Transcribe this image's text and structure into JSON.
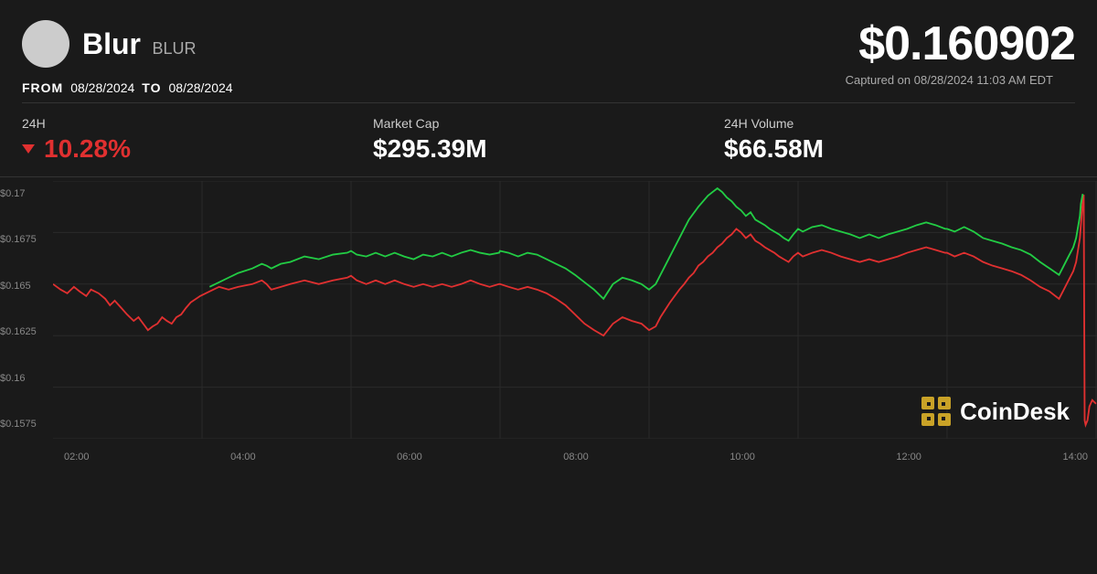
{
  "header": {
    "coin_name": "Blur",
    "coin_ticker": "BLUR",
    "price": "$0.160902",
    "date_from_label": "FROM",
    "date_from": "08/28/2024",
    "date_to_label": "TO",
    "date_to": "08/28/2024",
    "captured_label": "Captured on 08/28/2024 11:03 AM EDT"
  },
  "stats": {
    "change_24h_label": "24H",
    "change_24h_value": "▼ 10.28%",
    "market_cap_label": "Market Cap",
    "market_cap_value": "$295.39M",
    "volume_24h_label": "24H Volume",
    "volume_24h_value": "$66.58M"
  },
  "chart": {
    "y_labels": [
      "$0.17",
      "$0.1675",
      "$0.165",
      "$0.1625",
      "$0.16",
      "$0.1575"
    ],
    "x_labels": [
      "02:00",
      "04:00",
      "06:00",
      "08:00",
      "10:00",
      "12:00",
      "14:00"
    ]
  },
  "coindesk": {
    "text": "CoinDesk"
  }
}
